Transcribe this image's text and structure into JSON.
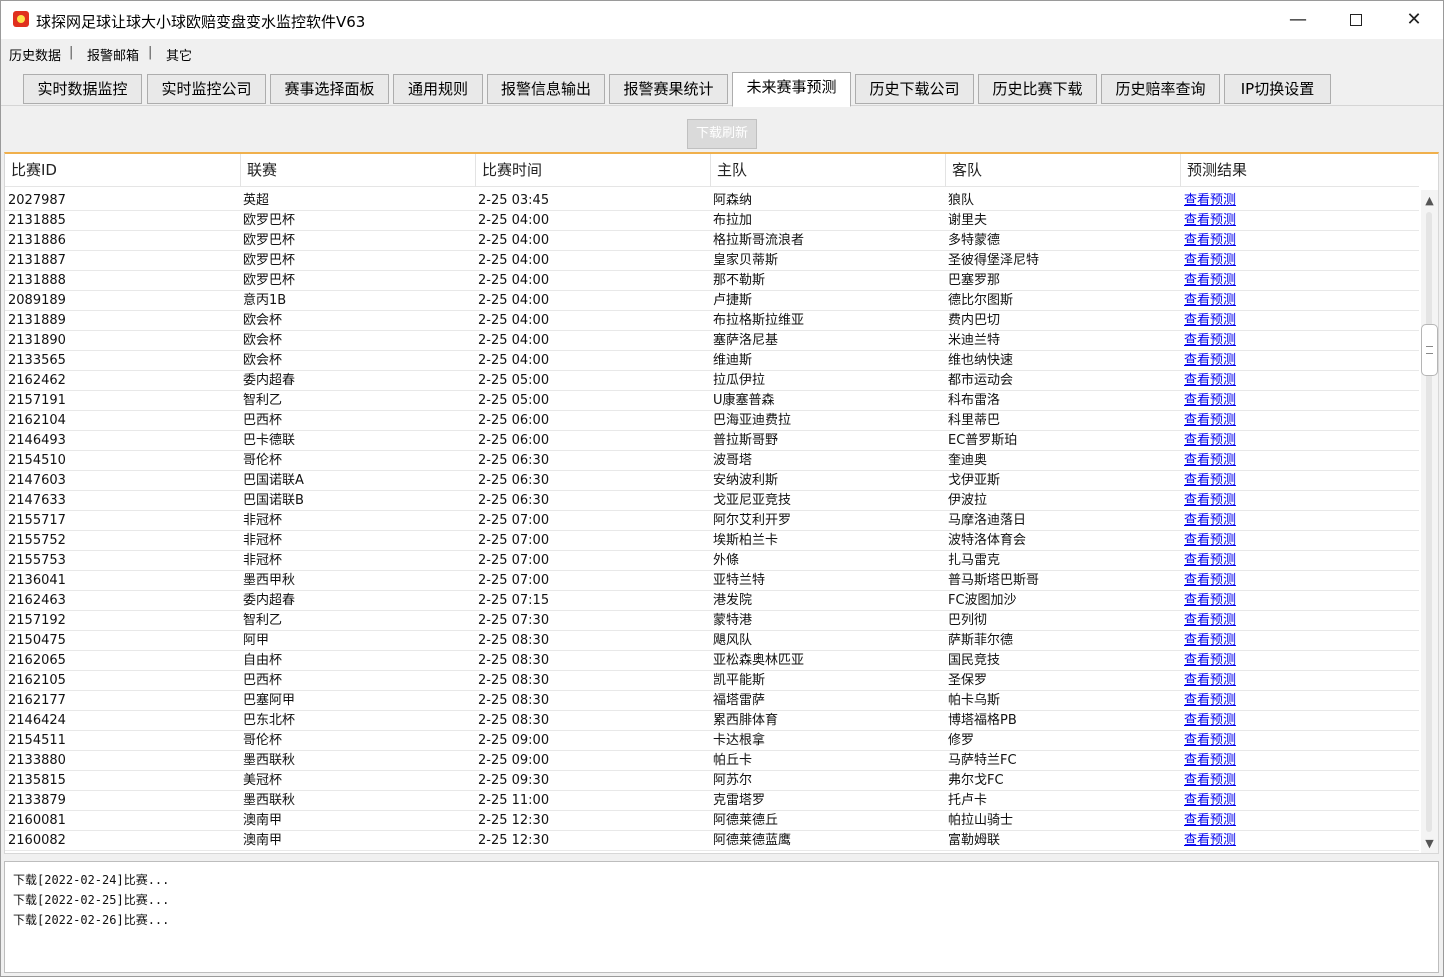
{
  "window": {
    "title": "球探网足球让球大小球欧赔变盘变水监控软件V63",
    "minimize": "—",
    "close": "✕"
  },
  "menu": [
    "历史数据",
    "报警邮箱",
    "其它"
  ],
  "tabs": [
    {
      "label": "实时数据监控",
      "active": false
    },
    {
      "label": "实时监控公司",
      "active": false
    },
    {
      "label": "赛事选择面板",
      "active": false
    },
    {
      "label": "通用规则",
      "active": false
    },
    {
      "label": "报警信息输出",
      "active": false
    },
    {
      "label": "报警赛果统计",
      "active": false
    },
    {
      "label": "未来赛事预测",
      "active": true
    },
    {
      "label": "历史下载公司",
      "active": false
    },
    {
      "label": "历史比赛下载",
      "active": false
    },
    {
      "label": "历史赔率查询",
      "active": false
    },
    {
      "label": "IP切换设置",
      "active": false
    }
  ],
  "download_button": "下载刷新",
  "columns": [
    "比赛ID",
    "联赛",
    "比赛时间",
    "主队",
    "客队",
    "预测结果"
  ],
  "rows": [
    [
      "2027987",
      "英超",
      "2-25 03:45",
      "阿森纳",
      "狼队",
      "查看预测"
    ],
    [
      "2131885",
      "欧罗巴杯",
      "2-25 04:00",
      "布拉加",
      "谢里夫",
      "查看预测"
    ],
    [
      "2131886",
      "欧罗巴杯",
      "2-25 04:00",
      "格拉斯哥流浪者",
      "多特蒙德",
      "查看预测"
    ],
    [
      "2131887",
      "欧罗巴杯",
      "2-25 04:00",
      "皇家贝蒂斯",
      "圣彼得堡泽尼特",
      "查看预测"
    ],
    [
      "2131888",
      "欧罗巴杯",
      "2-25 04:00",
      "那不勒斯",
      "巴塞罗那",
      "查看预测"
    ],
    [
      "2089189",
      "意丙1B",
      "2-25 04:00",
      "卢捷斯",
      "德比尔图斯",
      "查看预测"
    ],
    [
      "2131889",
      "欧会杯",
      "2-25 04:00",
      "布拉格斯拉维亚",
      "费内巴切",
      "查看预测"
    ],
    [
      "2131890",
      "欧会杯",
      "2-25 04:00",
      "塞萨洛尼基",
      "米迪兰特",
      "查看预测"
    ],
    [
      "2133565",
      "欧会杯",
      "2-25 04:00",
      "维迪斯",
      "维也纳快速",
      "查看预测"
    ],
    [
      "2162462",
      "委内超春",
      "2-25 05:00",
      "拉瓜伊拉",
      "都市运动会",
      "查看预测"
    ],
    [
      "2157191",
      "智利乙",
      "2-25 05:00",
      "U康塞普森",
      "科布雷洛",
      "查看预测"
    ],
    [
      "2162104",
      "巴西杯",
      "2-25 06:00",
      "巴海亚迪费拉",
      "科里蒂巴",
      "查看预测"
    ],
    [
      "2146493",
      "巴卡德联",
      "2-25 06:00",
      "普拉斯哥野",
      "EC普罗斯珀",
      "查看预测"
    ],
    [
      "2154510",
      "哥伦杯",
      "2-25 06:30",
      "波哥塔",
      "奎迪奥",
      "查看预测"
    ],
    [
      "2147603",
      "巴国诺联A",
      "2-25 06:30",
      "安纳波利斯",
      "戈伊亚斯",
      "查看预测"
    ],
    [
      "2147633",
      "巴国诺联B",
      "2-25 06:30",
      "戈亚尼亚竞技",
      "伊波拉",
      "查看预测"
    ],
    [
      "2155717",
      "非冠杯",
      "2-25 07:00",
      "阿尔艾利开罗",
      "马摩洛迪落日",
      "查看预测"
    ],
    [
      "2155752",
      "非冠杯",
      "2-25 07:00",
      "埃斯柏兰卡",
      "波特洛体育会",
      "查看预测"
    ],
    [
      "2155753",
      "非冠杯",
      "2-25 07:00",
      "外條",
      "扎马雷克",
      "查看预测"
    ],
    [
      "2136041",
      "墨西甲秋",
      "2-25 07:00",
      "亚特兰特",
      "普马斯塔巴斯哥",
      "查看预测"
    ],
    [
      "2162463",
      "委内超春",
      "2-25 07:15",
      "港发院",
      "FC波图加沙",
      "查看预测"
    ],
    [
      "2157192",
      "智利乙",
      "2-25 07:30",
      "蒙特港",
      "巴列彻",
      "查看预测"
    ],
    [
      "2150475",
      "阿甲",
      "2-25 08:30",
      "飓风队",
      "萨斯菲尔德",
      "查看预测"
    ],
    [
      "2162065",
      "自由杯",
      "2-25 08:30",
      "亚松森奥林匹亚",
      "国民竞技",
      "查看预测"
    ],
    [
      "2162105",
      "巴西杯",
      "2-25 08:30",
      "凯平能斯",
      "圣保罗",
      "查看预测"
    ],
    [
      "2162177",
      "巴塞阿甲",
      "2-25 08:30",
      "福塔雷萨",
      "帕卡乌斯",
      "查看预测"
    ],
    [
      "2146424",
      "巴东北杯",
      "2-25 08:30",
      "累西腓体育",
      "博塔福格PB",
      "查看预测"
    ],
    [
      "2154511",
      "哥伦杯",
      "2-25 09:00",
      "卡达根拿",
      "修罗",
      "查看预测"
    ],
    [
      "2133880",
      "墨西联秋",
      "2-25 09:00",
      "帕丘卡",
      "马萨特兰FC",
      "查看预测"
    ],
    [
      "2135815",
      "美冠杯",
      "2-25 09:30",
      "阿苏尔",
      "弗尔戈FC",
      "查看预测"
    ],
    [
      "2133879",
      "墨西联秋",
      "2-25 11:00",
      "克雷塔罗",
      "托卢卡",
      "查看预测"
    ],
    [
      "2160081",
      "澳南甲",
      "2-25 12:30",
      "阿德莱德丘",
      "帕拉山骑士",
      "查看预测"
    ],
    [
      "2160082",
      "澳南甲",
      "2-25 12:30",
      "阿德莱德蓝鹰",
      "富勒姆联",
      "查看预测"
    ]
  ],
  "log": [
    "下载[2022-02-24]比赛...",
    "下载[2022-02-25]比赛...",
    "下载[2022-02-26]比赛..."
  ]
}
